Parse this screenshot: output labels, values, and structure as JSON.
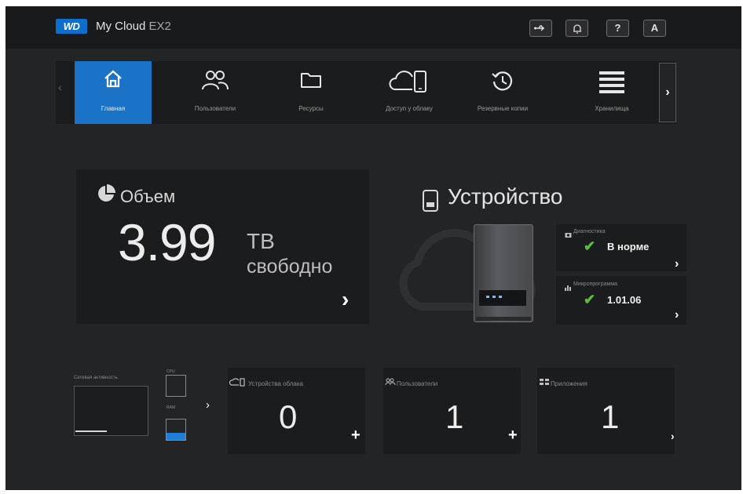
{
  "header": {
    "logo_text": "WD",
    "product_main": "My Cloud",
    "product_model": "EX2",
    "icons": [
      "usb-icon",
      "bell-icon",
      "help-icon",
      "user-icon"
    ],
    "help_label": "?",
    "user_label": "A"
  },
  "nav": {
    "items": [
      {
        "label": "Главная",
        "icon": "home-icon",
        "active": true
      },
      {
        "label": "Пользователи",
        "icon": "users-icon",
        "active": false
      },
      {
        "label": "Ресурсы",
        "icon": "folder-icon",
        "active": false
      },
      {
        "label": "Доступ у облаку",
        "icon": "cloud-device-icon",
        "active": false
      },
      {
        "label": "Резервные копии",
        "icon": "history-icon",
        "active": false
      },
      {
        "label": "Хранилища",
        "icon": "storage-icon",
        "active": false
      }
    ],
    "prev_label": "‹",
    "next_label": "›"
  },
  "volume": {
    "title": "Объем",
    "value": "3.99",
    "unit": "TB",
    "suffix": "свободно",
    "arrow": "›"
  },
  "device": {
    "title": "Устройство",
    "diagnostics_label": "Диагностика",
    "diagnostics_value": "В норме",
    "firmware_label": "Микропрограмма",
    "firmware_value": "1.01.06",
    "arrow": "›"
  },
  "performance": {
    "title": "Сетевая активность",
    "cpu_label": "CPU",
    "ram_label": "RAM",
    "ram_level": 0.35,
    "arrow": "›"
  },
  "counters": [
    {
      "label": "Устройства облака",
      "icon": "cloud-device-icon",
      "value": "0",
      "action": "+"
    },
    {
      "label": "Пользователи",
      "icon": "users-icon",
      "value": "1",
      "action": "+"
    },
    {
      "label": "Приложения",
      "icon": "apps-icon",
      "value": "1",
      "action": "›"
    }
  ],
  "colors": {
    "accent": "#1a73c6",
    "brand": "#0d6fcb",
    "ok": "#5bbf3a",
    "background": "#232425"
  }
}
